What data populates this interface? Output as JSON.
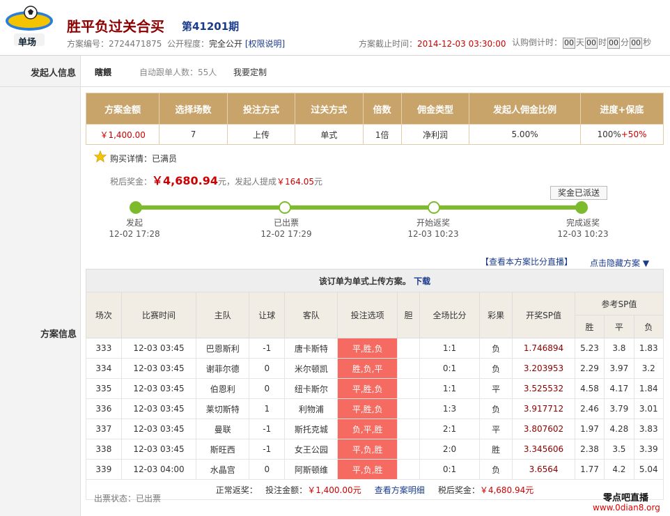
{
  "header": {
    "title": "胜平负过关合买",
    "issue": "第41201期",
    "logo_text": "单场",
    "plan_no_label": "方案编号：",
    "plan_no": "2724471875",
    "visibility_label": "公开程度：",
    "visibility": "完全公开",
    "permission_link": "[权限说明]",
    "deadline_label": "方案截止时间：",
    "deadline": "2014-12-03 03:30:00",
    "countdown_label": "认购倒计时：",
    "countdown": [
      {
        "value": "00",
        "unit": "天"
      },
      {
        "value": "00",
        "unit": "时"
      },
      {
        "value": "00",
        "unit": "分"
      },
      {
        "value": "00",
        "unit": "秒"
      }
    ]
  },
  "initiator": {
    "section_label": "发起人信息",
    "name": "瞎餵",
    "followers_label": "自动跟单人数：",
    "followers": "55人",
    "custom_link": "我要定制"
  },
  "plan": {
    "section_label": "方案信息",
    "summary_headers": [
      "方案金额",
      "选择场数",
      "投注方式",
      "过关方式",
      "倍数",
      "佣金类型",
      "发起人佣金比例",
      "进度+保底"
    ],
    "summary_values": [
      "￥1,400.00",
      "7",
      "上传",
      "单式",
      "1倍",
      "净利润",
      "5.00%",
      "100%"
    ],
    "guarantee": "+50%",
    "purchase_label": "购买详情：",
    "purchase_status": "已满员",
    "after_tax_label": "税后奖金：",
    "after_tax_amount": "￥4,680.94",
    "after_tax_unit": "元，发起人提成",
    "commission": "￥164.05",
    "commission_unit": "元",
    "prize_sent": "奖金已派送",
    "progress": [
      {
        "label": "发起",
        "time": "12-02 17:28"
      },
      {
        "label": "已出票",
        "time": "12-02 17:29"
      },
      {
        "label": "开始返奖",
        "time": "12-03 10:23"
      },
      {
        "label": "完成返奖",
        "time": "12-03 10:23"
      }
    ],
    "live_link": "【查看本方案比分直播】",
    "hide_link": "点击隐藏方案 ▼",
    "caption": "该订单为单式上传方案。",
    "download": "下载",
    "columns": [
      "场次",
      "比赛时间",
      "主队",
      "让球",
      "客队",
      "投注选项",
      "胆",
      "全场比分",
      "彩果",
      "开奖SP值",
      "参考SP值"
    ],
    "sp_sub": [
      "胜",
      "平",
      "负"
    ],
    "rows": [
      {
        "no": "333",
        "time": "12-03 03:45",
        "home": "巴恩斯利",
        "hcp": "-1",
        "away": "唐卡斯特",
        "pick": "平,胜,负",
        "banker": "",
        "score": "1:1",
        "result": "负",
        "sp": "1.746894",
        "w": "5.23",
        "d": "3.8",
        "l": "1.83"
      },
      {
        "no": "334",
        "time": "12-03 03:45",
        "home": "谢菲尔德",
        "hcp": "0",
        "away": "米尔顿凯",
        "pick": "胜,负,平",
        "banker": "",
        "score": "0:1",
        "result": "负",
        "sp": "3.203953",
        "w": "2.29",
        "d": "3.97",
        "l": "3.2"
      },
      {
        "no": "335",
        "time": "12-03 03:45",
        "home": "伯恩利",
        "hcp": "0",
        "away": "纽卡斯尔",
        "pick": "平,胜,负",
        "banker": "",
        "score": "1:1",
        "result": "平",
        "sp": "3.525532",
        "w": "4.58",
        "d": "4.17",
        "l": "1.84"
      },
      {
        "no": "336",
        "time": "12-03 03:45",
        "home": "莱切斯特",
        "hcp": "1",
        "away": "利物浦",
        "pick": "平,胜,负",
        "banker": "",
        "score": "1:3",
        "result": "负",
        "sp": "3.917712",
        "w": "2.46",
        "d": "3.79",
        "l": "3.01"
      },
      {
        "no": "337",
        "time": "12-03 03:45",
        "home": "曼联",
        "hcp": "-1",
        "away": "斯托克城",
        "pick": "负,平,胜",
        "banker": "",
        "score": "2:1",
        "result": "平",
        "sp": "3.807602",
        "w": "1.97",
        "d": "4.28",
        "l": "3.83"
      },
      {
        "no": "338",
        "time": "12-03 03:45",
        "home": "斯旺西",
        "hcp": "-1",
        "away": "女王公园",
        "pick": "平,负,胜",
        "banker": "",
        "score": "2:0",
        "result": "胜",
        "sp": "3.345606",
        "w": "2.38",
        "d": "3.5",
        "l": "3.39"
      },
      {
        "no": "339",
        "time": "12-03 04:00",
        "home": "水晶宫",
        "hcp": "0",
        "away": "阿斯顿维",
        "pick": "平,负,胜",
        "banker": "",
        "score": "0:1",
        "result": "负",
        "sp": "3.6564",
        "w": "1.77",
        "d": "4.2",
        "l": "5.04"
      }
    ],
    "footer_status": "正常返奖：",
    "footer_bet_label": "投注金额：",
    "footer_bet": "￥1,400.00元",
    "footer_detail_link": "查看方案明细",
    "footer_prize_label": "税后奖金：",
    "footer_prize": "￥4,680.94元",
    "ticket_status_label": "出票状态：",
    "ticket_status": "已出票"
  },
  "watermark": {
    "line1": "零点吧直播",
    "line2": "www.0dian8.org"
  },
  "colors": {
    "header_gold": "#c9a46a",
    "pick_red": "#f56b61",
    "progress_green": "#7dbb2c",
    "title_red": "#8b0000"
  }
}
